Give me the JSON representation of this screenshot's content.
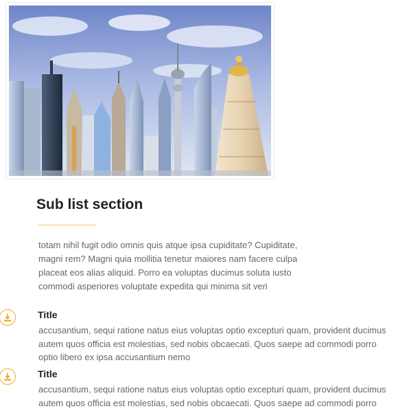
{
  "hero": {
    "image": "city-skyline-illustration"
  },
  "section": {
    "title": "Sub list section",
    "intro": "totam nihil fugit odio omnis quis atque ipsa cupiditate? Cupiditate, magni rem? Magni quia mollitia tenetur maiores nam facere culpa placeat eos alias aliquid. Porro ea voluptas ducimus soluta iusto commodi asperiores voluptate expedita qui minima sit veri"
  },
  "items": [
    {
      "icon": "download-icon",
      "title": "Title",
      "text": "accusantium, sequi ratione natus eius voluptas optio excepturi quam, provident ducimus autem quos officia est molestias, sed nobis obcaecati. Quos saepe ad commodi porro optio libero ex ipsa accusantium nemo"
    },
    {
      "icon": "download-icon",
      "title": "Title",
      "text": "accusantium, sequi ratione natus eius voluptas optio excepturi quam, provident ducimus autem quos officia est molestias, sed nobis obcaecati. Quos saepe ad commodi porro"
    }
  ],
  "colors": {
    "accent": "#f2a623",
    "underline": "#fde9c7",
    "heading": "#222222",
    "body": "#666666"
  }
}
